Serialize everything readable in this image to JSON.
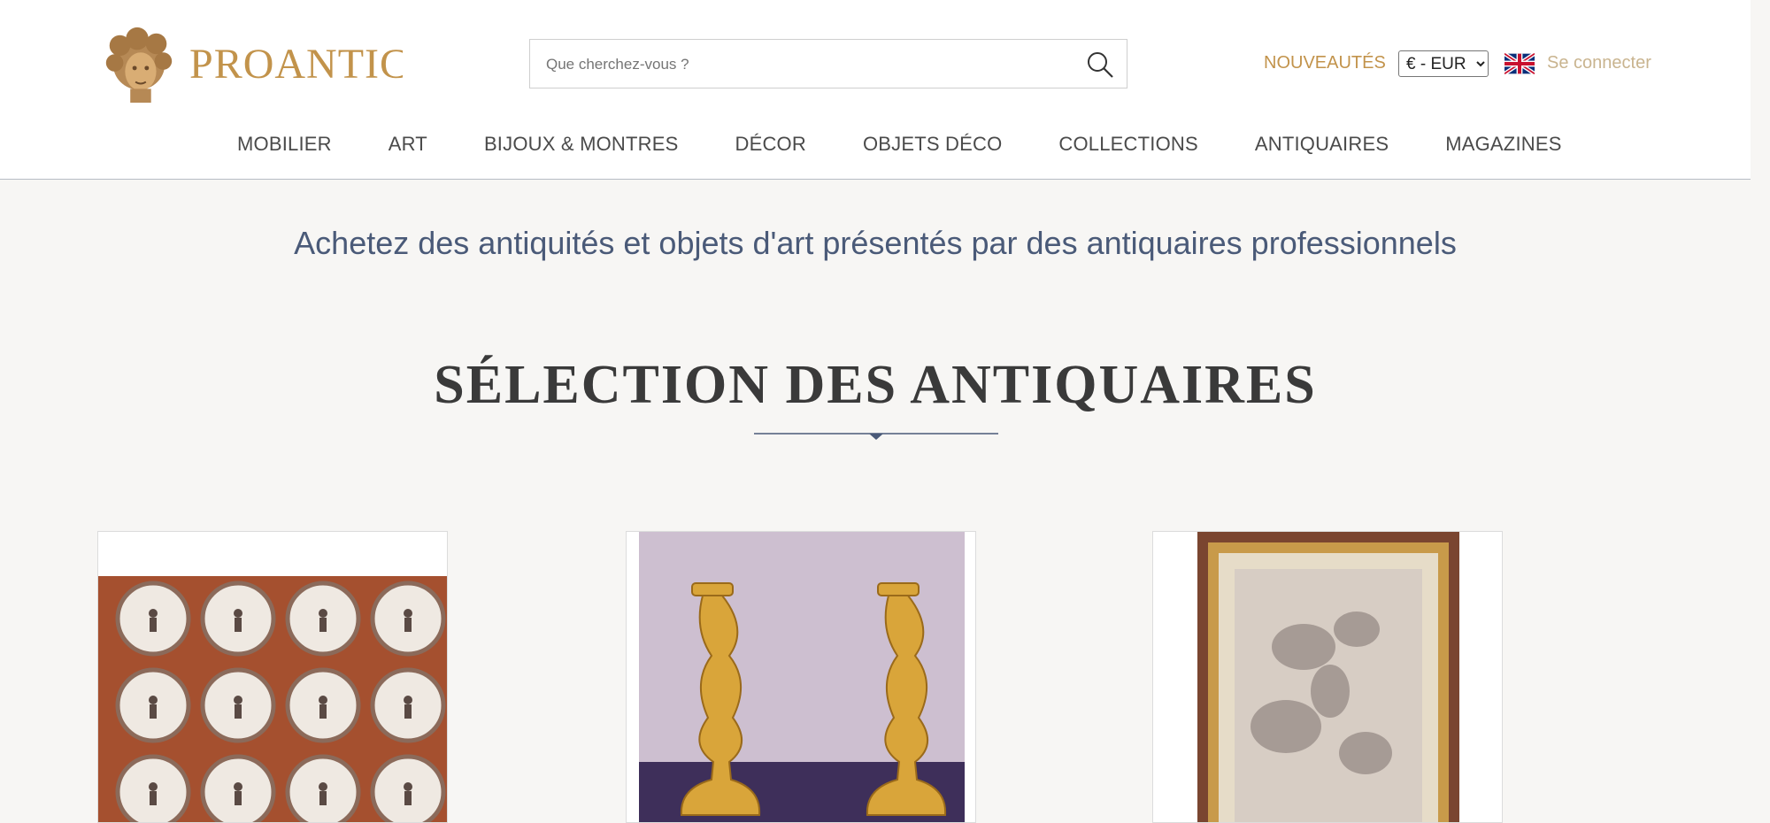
{
  "header": {
    "logo_text": "PROANTIC",
    "search": {
      "placeholder": "Que cherchez-vous ?",
      "value": ""
    },
    "nouveautes_label": "NOUVEAUTÉS",
    "currency": {
      "selected": "€ - EUR"
    },
    "language_flag": "uk-flag-icon",
    "login_label": "Se connecter"
  },
  "nav": {
    "items": [
      {
        "label": "MOBILIER"
      },
      {
        "label": "ART"
      },
      {
        "label": "BIJOUX & MONTRES"
      },
      {
        "label": "DÉCOR"
      },
      {
        "label": "OBJETS DÉCO"
      },
      {
        "label": "COLLECTIONS"
      },
      {
        "label": "ANTIQUAIRES"
      },
      {
        "label": "MAGAZINES"
      }
    ]
  },
  "main": {
    "tagline": "Achetez des antiquités et objets d'art présentés par des antiquaires professionnels",
    "section_title": "SÉLECTION DES ANTIQUAIRES",
    "products": [
      {
        "image": "plates-collection-image"
      },
      {
        "image": "gilt-candlesticks-image"
      },
      {
        "image": "framed-drawing-image"
      }
    ]
  },
  "colors": {
    "accent_gold": "#c2934b",
    "heading_blue": "#4a5a78",
    "page_bg": "#f7f6f4"
  }
}
